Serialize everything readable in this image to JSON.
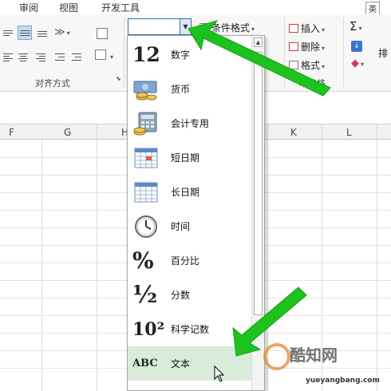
{
  "menu": {
    "tabs": [
      "审阅",
      "视图",
      "开发工具"
    ],
    "corner": "英"
  },
  "ribbon": {
    "alignment_group_label": "对齐方式",
    "number_format_value": "",
    "conditional_format_label": "条件格式",
    "insert_label": "插入",
    "delete_label": "删除",
    "format_label": "格式",
    "cells_group_label": "单元格",
    "sort_label": "排"
  },
  "grid": {
    "columns": [
      "F",
      "G",
      "H",
      "K",
      "L"
    ]
  },
  "dropdown": {
    "items": [
      {
        "label": "数字",
        "icon": "number-12-icon",
        "glyph": "12"
      },
      {
        "label": "货币",
        "icon": "currency-icon"
      },
      {
        "label": "会计专用",
        "icon": "accounting-icon"
      },
      {
        "label": "短日期",
        "icon": "short-date-calendar-icon"
      },
      {
        "label": "长日期",
        "icon": "long-date-calendar-icon"
      },
      {
        "label": "时间",
        "icon": "clock-icon"
      },
      {
        "label": "百分比",
        "icon": "percent-icon",
        "glyph": "%"
      },
      {
        "label": "分数",
        "icon": "fraction-icon",
        "glyph": "½"
      },
      {
        "label": "科学记数",
        "icon": "scientific-icon",
        "glyph": "10²"
      },
      {
        "label": "文本",
        "icon": "text-abc-icon",
        "glyph": "ABC"
      }
    ],
    "selected_index": 9
  },
  "watermark": {
    "brand": "酷知网",
    "sub": "yueyangbang.com"
  },
  "colors": {
    "arrow": "#1ec21e",
    "selected_bg": "#d9ecd9",
    "accent": "#2b6fb8"
  }
}
